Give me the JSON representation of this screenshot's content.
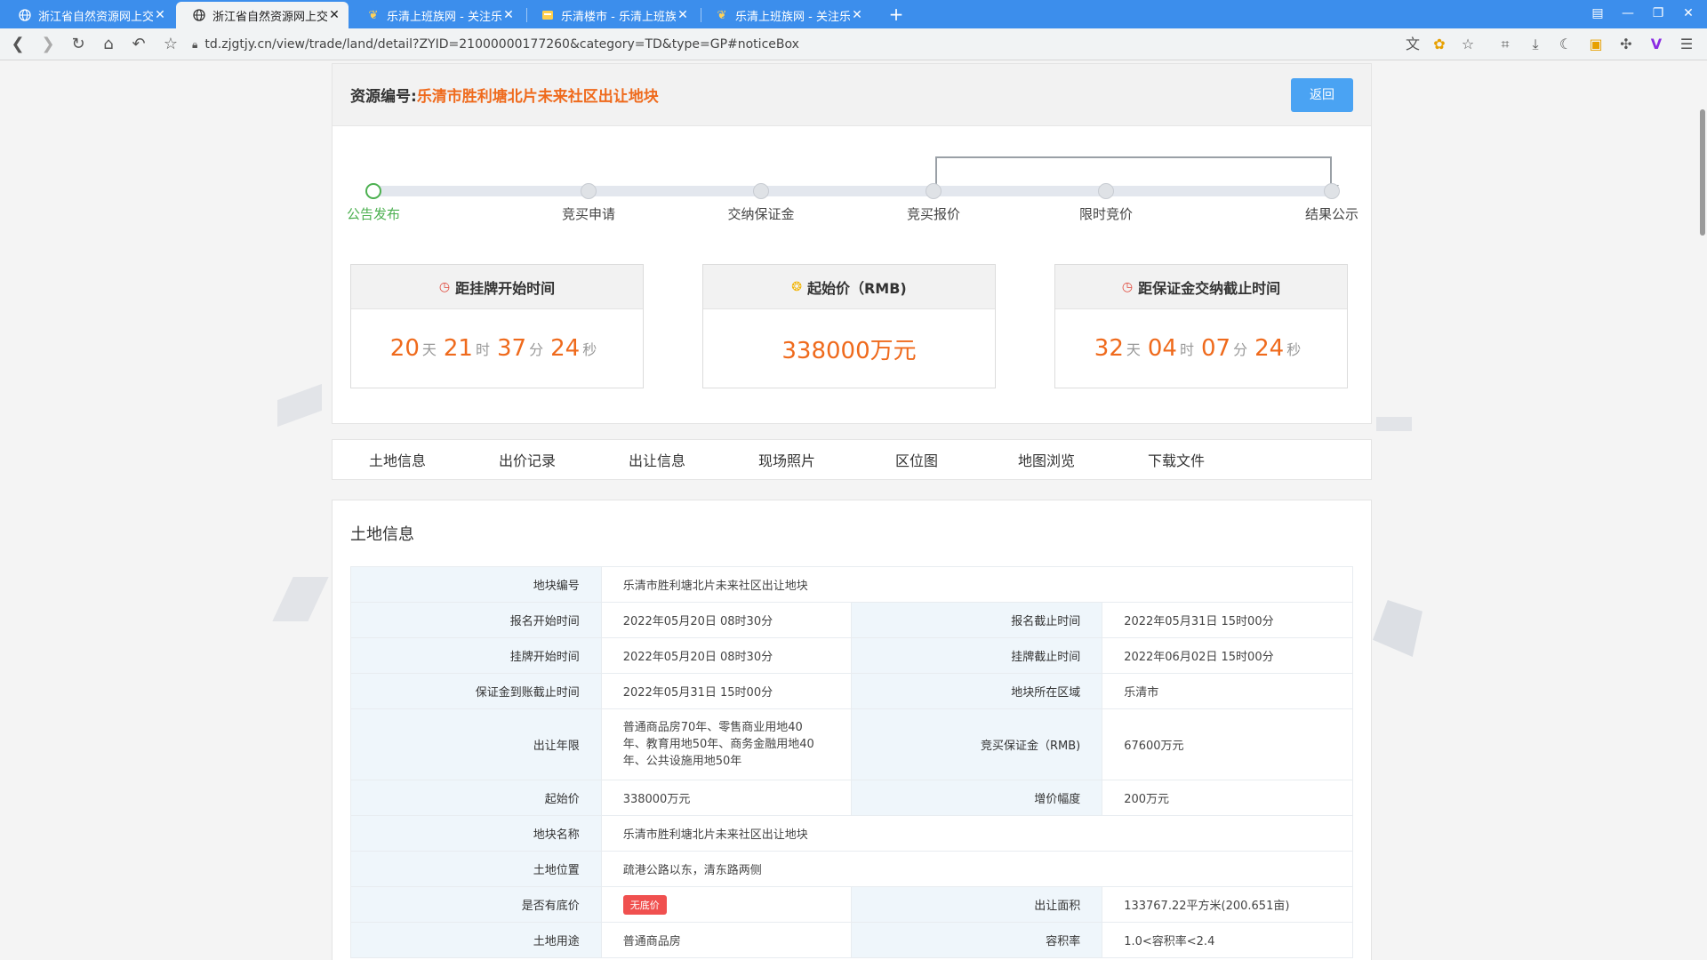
{
  "browser": {
    "tabs": [
      {
        "label": "浙江省自然资源网上交易",
        "icon": "globe-icon",
        "active": false
      },
      {
        "label": "浙江省自然资源网上交易",
        "icon": "globe-icon",
        "active": true
      },
      {
        "label": "乐清上班族网 - 关注乐",
        "icon": "leaf-icon",
        "active": false
      },
      {
        "label": "乐清楼市 - 乐清上班族",
        "icon": "folder-icon",
        "active": false
      },
      {
        "label": "乐清上班族网 - 关注乐",
        "icon": "leaf-icon",
        "active": false
      }
    ],
    "url": "td.zjgtjy.cn/view/trade/land/detail?ZYID=21000000177260&category=TD&type=GP#noticeBox"
  },
  "header": {
    "resource_label": "资源编号:",
    "resource_value": "乐清市胜利塘北片未来社区出让地块",
    "back_label": "返回"
  },
  "steps": [
    {
      "label": "公告发布",
      "done": true
    },
    {
      "label": "竞买申请",
      "done": false
    },
    {
      "label": "交纳保证金",
      "done": false
    },
    {
      "label": "竞买报价",
      "done": false
    },
    {
      "label": "限时竞价",
      "done": false
    },
    {
      "label": "结果公示",
      "done": false
    }
  ],
  "countdown_start": {
    "title": "距挂牌开始时间",
    "days": "20",
    "days_unit": "天",
    "hours": "21",
    "hours_unit": "时",
    "minutes": "37",
    "minutes_unit": "分",
    "seconds": "24",
    "seconds_unit": "秒"
  },
  "start_price": {
    "title": "起始价（RMB)",
    "value": "338000万元"
  },
  "countdown_deposit": {
    "title": "距保证金交纳截止时间",
    "days": "32",
    "days_unit": "天",
    "hours": "04",
    "hours_unit": "时",
    "minutes": "07",
    "minutes_unit": "分",
    "seconds": "24",
    "seconds_unit": "秒"
  },
  "info_tabs": [
    "土地信息",
    "出价记录",
    "出让信息",
    "现场照片",
    "区位图",
    "地图浏览",
    "下载文件"
  ],
  "land": {
    "title": "土地信息",
    "rows": {
      "r0": {
        "k1": "地块编号",
        "v1": "乐清市胜利塘北片未来社区出让地块"
      },
      "r1": {
        "k1": "报名开始时间",
        "v1": "2022年05月20日 08时30分",
        "k2": "报名截止时间",
        "v2": "2022年05月31日 15时00分"
      },
      "r2": {
        "k1": "挂牌开始时间",
        "v1": "2022年05月20日 08时30分",
        "k2": "挂牌截止时间",
        "v2": "2022年06月02日 15时00分"
      },
      "r3": {
        "k1": "保证金到账截止时间",
        "v1": "2022年05月31日 15时00分",
        "k2": "地块所在区域",
        "v2": "乐清市"
      },
      "r4": {
        "k1": "出让年限",
        "v1a": "普通商品房70年、零售商业用地40",
        "v1b": "年、教育用地50年、商务金融用地40",
        "v1c": "年、公共设施用地50年",
        "k2": "竞买保证金（RMB)",
        "v2": "67600万元"
      },
      "r5": {
        "k1": "起始价",
        "v1": "338000万元",
        "k2": "增价幅度",
        "v2": "200万元"
      },
      "r6": {
        "k1": "地块名称",
        "v1": "乐清市胜利塘北片未来社区出让地块"
      },
      "r7": {
        "k1": "土地位置",
        "v1": "疏港公路以东，清东路两侧"
      },
      "r8": {
        "k1": "是否有底价",
        "v1": "无底价",
        "k2": "出让面积",
        "v2": "133767.22平方米(200.651亩)"
      },
      "r9": {
        "k1": "土地用途",
        "v1": "普通商品房",
        "k2": "容积率",
        "v2": "1.0<容积率<2.4"
      }
    }
  },
  "colors": {
    "accent": "#ef6a1c",
    "button": "#4aa3f3",
    "done": "#4cb050",
    "badge": "#f0504f"
  }
}
